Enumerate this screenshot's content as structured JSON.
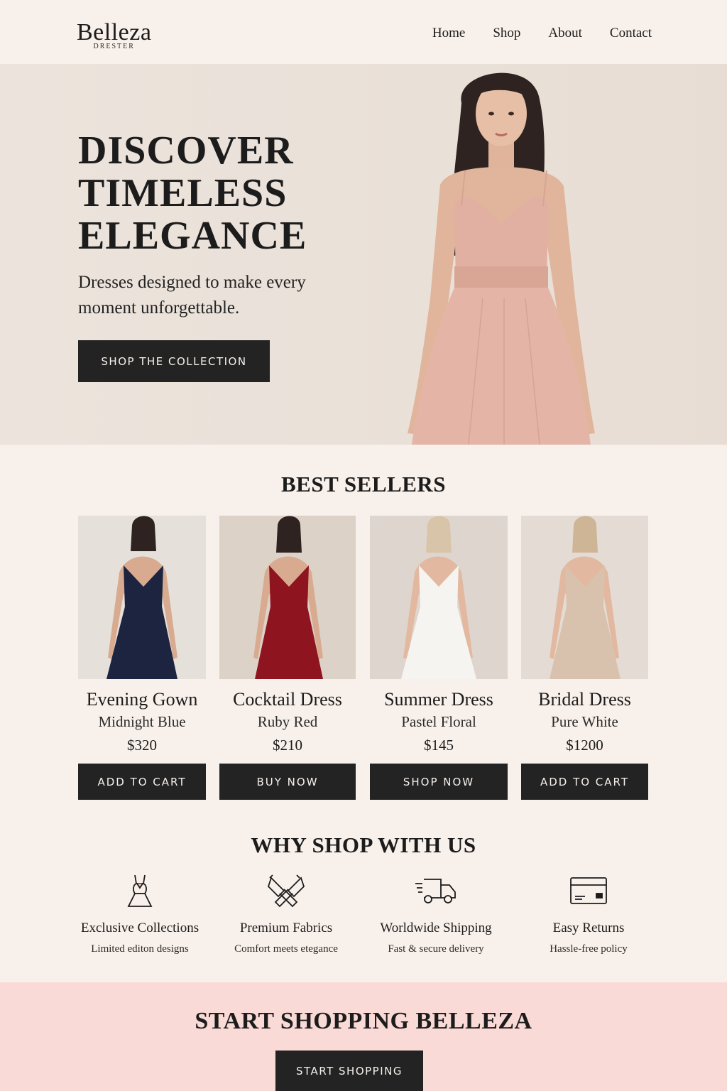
{
  "brand": {
    "name": "Belleza",
    "tagline": "DRESTER"
  },
  "nav": {
    "items": [
      "Home",
      "Shop",
      "About",
      "Contact"
    ]
  },
  "hero": {
    "title_lines": [
      "DISCOVER",
      "TIMELESS",
      "ELEGANCE"
    ],
    "subtitle": "Dresses designed to make every moment unforgettable.",
    "cta_label": "SHOP THE COLLECTION"
  },
  "best_sellers": {
    "title": "BEST SELLERS",
    "products": [
      {
        "name": "Evening Gown",
        "color": "Midnight Blue",
        "price": "$320",
        "button": "ADD TO CART",
        "dress_hex": "#1c2440",
        "bg_hex": "#e6e0da"
      },
      {
        "name": "Cocktail Dress",
        "color": "Ruby Red",
        "price": "$210",
        "button": "BUY NOW",
        "dress_hex": "#8e1420",
        "bg_hex": "#ddd2c8"
      },
      {
        "name": "Summer Dress",
        "color": "Pastel Floral",
        "price": "$145",
        "button": "SHOP NOW",
        "dress_hex": "#f6f4f0",
        "bg_hex": "#ded6ce"
      },
      {
        "name": "Bridal Dress",
        "color": "Pure White",
        "price": "$1200",
        "button": "ADD TO CART",
        "dress_hex": "#d9c2ad",
        "bg_hex": "#e4dcd4"
      }
    ]
  },
  "why_shop": {
    "title": "WHY SHOP WITH US",
    "features": [
      {
        "title": "Exclusive Collections",
        "desc": "Limited editon designs",
        "icon": "dress-icon"
      },
      {
        "title": "Premium Fabrics",
        "desc": "Comfort meets etegance",
        "icon": "fabric-icon"
      },
      {
        "title": "Worldwide Shipping",
        "desc": "Fast & secure delivery",
        "icon": "truck-icon"
      },
      {
        "title": "Easy Returns",
        "desc": "Hassle-free policy",
        "icon": "card-icon"
      }
    ]
  },
  "footer_cta": {
    "title": "START SHOPPING BELLEZA",
    "button": "START SHOPPING"
  },
  "colors": {
    "background": "#f8f0ea",
    "dark_button": "#232323",
    "cta_band": "#fadad6",
    "hero_dress": "#e2b0a2"
  }
}
